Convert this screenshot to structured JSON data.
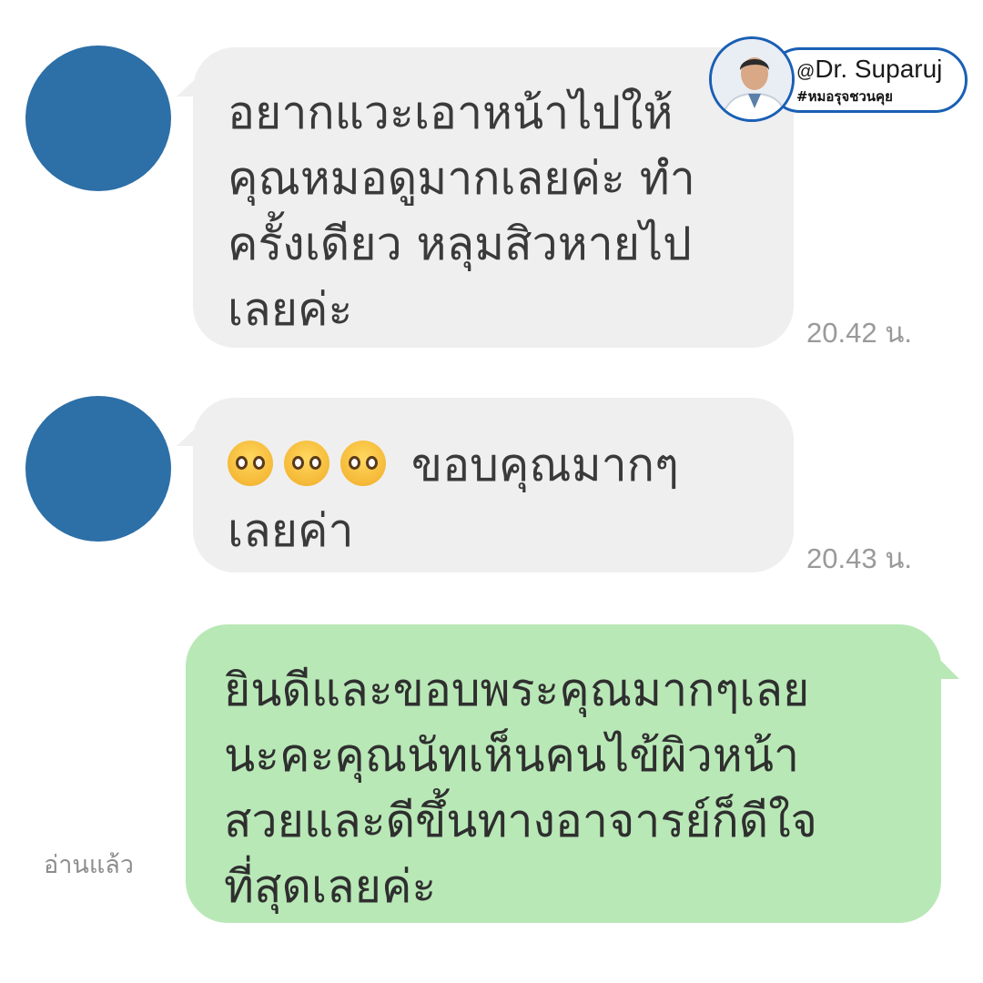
{
  "badge": {
    "handle_prefix": "@",
    "handle": "Dr. Suparuj",
    "hashtag": "#หมอรุจชวนคุย",
    "photo_icon": "doctor-avatar-icon"
  },
  "messages": [
    {
      "direction": "incoming",
      "lines": [
        "อยากแวะเอาหน้าไปให้",
        "คุณหมอดูมากเลยค่ะ ทำ",
        "ครั้งเดียว หลุมสิวหายไป",
        "เลยค่ะ"
      ],
      "time": "20.42 น."
    },
    {
      "direction": "incoming",
      "emoji_count": 3,
      "emoji_icon": "pleading-face-emoji-icon",
      "lines": [
        "ขอบคุณมากๆ",
        "เลยค่า"
      ],
      "time": "20.43 น."
    },
    {
      "direction": "outgoing",
      "lines": [
        "ยินดีและขอบพระคุณมากๆเลย",
        "นะคะคุณนัทเห็นคนไข้ผิวหน้า",
        "สวยและดีขึ้นทางอาจารย์ก็ดีใจ",
        "ที่สุดเลยค่ะ"
      ],
      "read_status": "อ่านแล้ว"
    }
  ],
  "colors": {
    "avatar": "#2d6fa7",
    "incoming_bubble": "#efefef",
    "outgoing_bubble": "#b9e8b7",
    "badge_border": "#1a5fb4"
  }
}
